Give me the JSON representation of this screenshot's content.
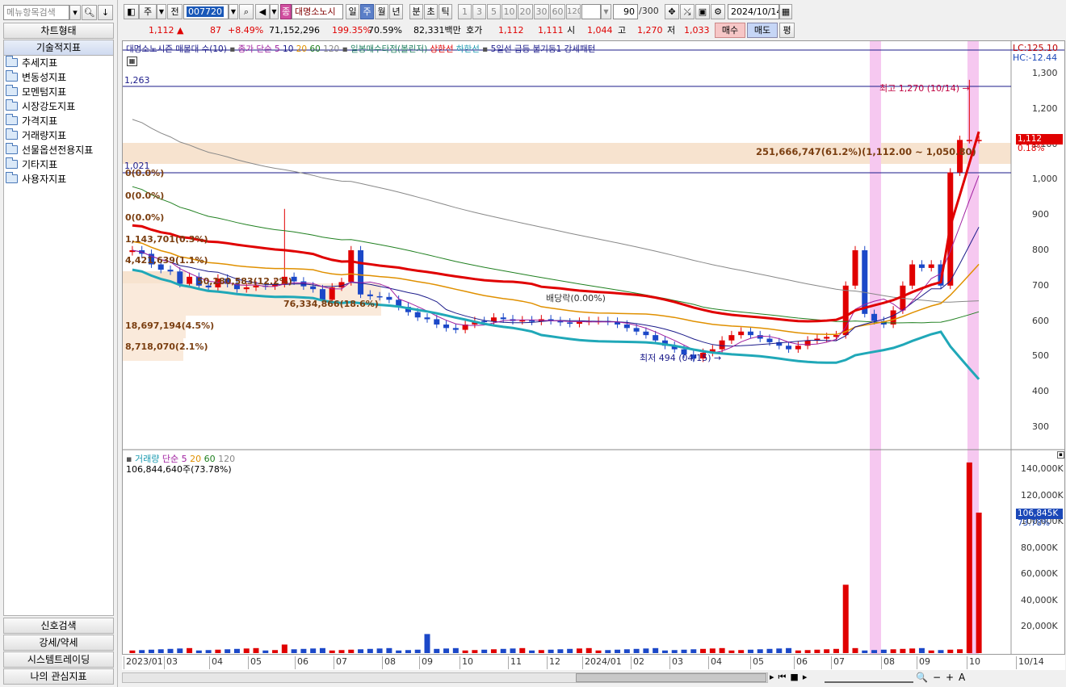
{
  "left": {
    "search_placeholder": "메뉴항목검색",
    "chart_type_btn": "차트형태",
    "tech_indicator_btn": "기술적지표",
    "tree_items": [
      "추세지표",
      "변동성지표",
      "모멘텀지표",
      "시장강도지표",
      "가격지표",
      "거래량지표",
      "선물옵션전용지표",
      "기타지표",
      "사용자지표"
    ],
    "bottom_btns": [
      "신호검색",
      "강세/약세",
      "시스템트레이딩",
      "나의 관심지표"
    ]
  },
  "toolbar": {
    "period_label": "주",
    "prev_label": "전",
    "code": "007720",
    "name_badge": "종",
    "name": "대명소노시",
    "periods": [
      "일",
      "주",
      "월",
      "년",
      "분",
      "초",
      "틱"
    ],
    "active_period": "주",
    "nums": [
      "1",
      "3",
      "5",
      "10",
      "20",
      "30",
      "60",
      "120"
    ],
    "count": "90",
    "count_total": "/300",
    "date": "2024/10/14"
  },
  "quote": {
    "price": "1,112",
    "change": "87",
    "change_pct": "+8.49%",
    "volume": "71,152,296",
    "vol_ratio": "199.35%",
    "turnover_pct": "70.59%",
    "amount": "82,331백만",
    "hoga_label": "호가",
    "ask": "1,112",
    "bid": "1,111",
    "open_label": "시",
    "open": "1,044",
    "high_label": "고",
    "high": "1,270",
    "low_label": "저",
    "low": "1,033",
    "buy_btn": "매수",
    "sell_btn": "매도",
    "flat_btn": "평"
  },
  "legend": {
    "title": "대명소노시즌 매물대 수(10)",
    "ma_label": "종가 단순",
    "ma_periods": [
      "5",
      "10",
      "20",
      "60",
      "120"
    ],
    "ichimoku": "일봉매수타점(볼린저)",
    "upper": "상한선",
    "lower": "하한선",
    "pattern": "5일선 급등 불기둥1 강세패턴"
  },
  "price_axis": {
    "ticks": [
      "1,300",
      "1,200",
      "1,100",
      "1,000",
      "900",
      "800",
      "700",
      "600",
      "500",
      "400",
      "300"
    ],
    "lc": "LC:125.10",
    "hc": "HC:-12.44",
    "current": "1,112",
    "current_pct": "0.18%"
  },
  "annotations": {
    "line_1263": "1,263",
    "line_1021": "1,021",
    "high_note": "최고 1,270 (10/14)",
    "low_note": "최저 494 (04/15)",
    "dividend": "배당락(0.00%)",
    "profile_main": "251,666,747(61.2%)(1,112.00 ~ 1,050.80)",
    "profile_labels": [
      "0(0.0%)",
      "0(0.0%)",
      "0(0.0%)",
      "1,143,701(0.3%)",
      "4,421,639(1.1%)",
      "50,280,583(12.2%)",
      "76,334,866(18.6%)",
      "18,697,194(4.5%)",
      "8,718,070(2.1%)"
    ]
  },
  "volume_legend": {
    "label": "거래량",
    "ma_label": "단순",
    "periods": [
      "5",
      "20",
      "60",
      "120"
    ],
    "summary": "106,844,640주(73.78%)",
    "axis": [
      "140,000K",
      "120,000K",
      "100,000K",
      "80,000K",
      "60,000K",
      "40,000K",
      "20,000K"
    ],
    "current": "106,845K",
    "current_pct": "73.78%"
  },
  "x_axis": [
    "2023/01",
    "03",
    "04",
    "05",
    "06",
    "07",
    "08",
    "09",
    "10",
    "11",
    "12",
    "2024/01",
    "02",
    "03",
    "04",
    "05",
    "06",
    "07",
    "08",
    "09",
    "10",
    "10/14"
  ],
  "chart_data": {
    "type": "candlestick",
    "timeframe": "weekly",
    "ylim": [
      250,
      1330
    ],
    "candles": [
      [
        2023.02,
        800,
        805,
        790,
        798
      ],
      [
        2023.04,
        795,
        820,
        780,
        790
      ],
      [
        2023.06,
        790,
        800,
        770,
        760
      ],
      [
        2023.08,
        760,
        770,
        740,
        745
      ],
      [
        2023.1,
        745,
        770,
        730,
        740
      ],
      [
        2023.12,
        740,
        745,
        720,
        705
      ],
      [
        2023.14,
        705,
        735,
        690,
        725
      ],
      [
        2023.16,
        725,
        740,
        700,
        700
      ],
      [
        2023.18,
        700,
        715,
        690,
        695
      ],
      [
        2023.2,
        695,
        725,
        690,
        720
      ],
      [
        2023.22,
        720,
        730,
        705,
        705
      ],
      [
        2023.24,
        705,
        715,
        690,
        690
      ],
      [
        2023.26,
        690,
        700,
        680,
        695
      ],
      [
        2023.28,
        695,
        705,
        680,
        700
      ],
      [
        2023.3,
        700,
        710,
        690,
        698
      ],
      [
        2023.32,
        698,
        900,
        690,
        705
      ],
      [
        2023.34,
        705,
        730,
        680,
        725
      ],
      [
        2023.36,
        725,
        740,
        700,
        712
      ],
      [
        2023.38,
        712,
        725,
        695,
        698
      ],
      [
        2023.4,
        698,
        710,
        680,
        690
      ],
      [
        2023.42,
        690,
        700,
        620,
        660
      ],
      [
        2023.44,
        660,
        700,
        640,
        695
      ],
      [
        2023.46,
        695,
        830,
        690,
        710
      ],
      [
        2023.48,
        710,
        720,
        660,
        800
      ],
      [
        2023.5,
        690,
        700,
        670,
        675
      ]
    ],
    "volume_k": [
      3200,
      2600,
      2400,
      2100,
      2000,
      6500,
      3100,
      2200,
      1900,
      14500,
      8200,
      3100,
      2600,
      2400,
      2200,
      1800,
      1700,
      1600,
      1500,
      1400,
      1800,
      1700,
      1600,
      2000,
      52000,
      4200,
      3100,
      2900,
      2700,
      3800,
      6200,
      145000,
      106845
    ],
    "high": 1270,
    "high_date": "10/14",
    "low": 494,
    "low_date": "04/15"
  }
}
